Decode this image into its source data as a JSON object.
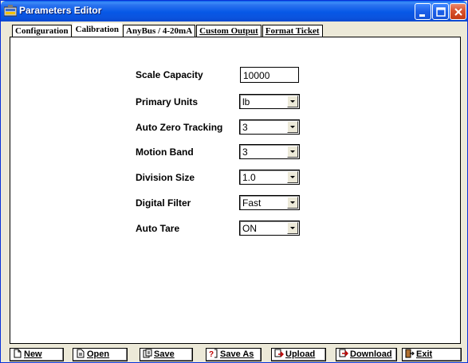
{
  "window": {
    "title": "Parameters Editor",
    "colors": {
      "titlebar": "#0758e6",
      "close": "#d8522e",
      "panel": "#ffffff",
      "chrome": "#ece9d8"
    }
  },
  "tabs": [
    {
      "label": "Configuration",
      "active": false
    },
    {
      "label": "Calibration",
      "active": true
    },
    {
      "label": "AnyBus / 4-20mA",
      "active": false
    },
    {
      "label": "Custom Output",
      "active": false
    },
    {
      "label": "Format Ticket",
      "active": false
    }
  ],
  "fields": {
    "scale_capacity": {
      "label": "Scale Capacity",
      "value": "10000"
    },
    "primary_units": {
      "label": "Primary Units",
      "value": "lb"
    },
    "auto_zero_tracking": {
      "label": "Auto Zero Tracking",
      "value": "3"
    },
    "motion_band": {
      "label": "Motion Band",
      "value": "3"
    },
    "division_size": {
      "label": "Division Size",
      "value": "1.0"
    },
    "digital_filter": {
      "label": "Digital Filter",
      "value": "Fast"
    },
    "auto_tare": {
      "label": "Auto Tare",
      "value": "ON"
    }
  },
  "toolbar": {
    "new": {
      "label": "New",
      "icon": "new-file-icon"
    },
    "open": {
      "label": "Open",
      "icon": "open-file-icon"
    },
    "save": {
      "label": "Save",
      "icon": "save-icon"
    },
    "save_as": {
      "label": "Save As",
      "icon": "save-as-icon"
    },
    "upload": {
      "label": "Upload",
      "icon": "upload-icon"
    },
    "download": {
      "label": "Download",
      "icon": "download-icon"
    },
    "exit": {
      "label": "Exit",
      "icon": "exit-icon"
    }
  }
}
